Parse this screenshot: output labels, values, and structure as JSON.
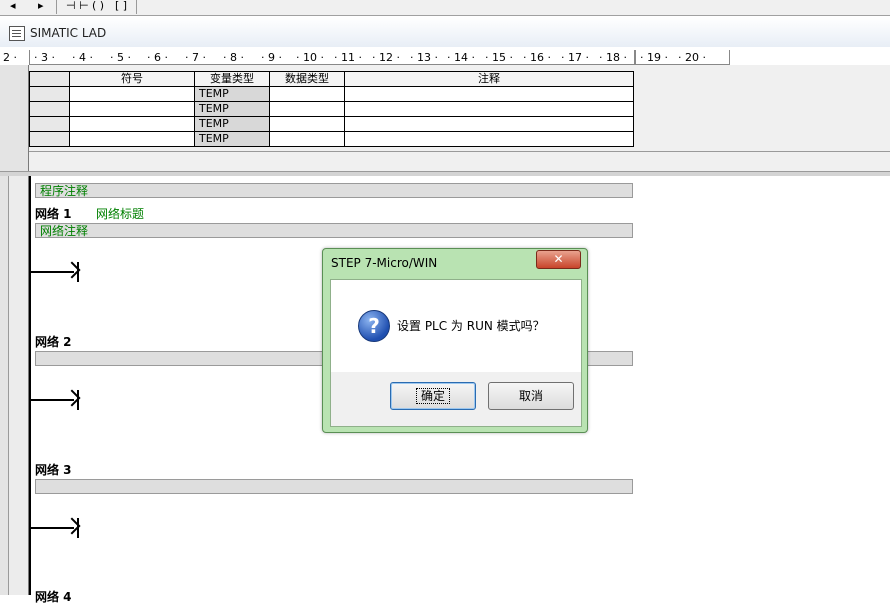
{
  "toolbar": {
    "items": [
      "◂",
      "▸",
      "⊣ ⊢",
      "( )",
      "[ ]"
    ]
  },
  "window": {
    "title": "SIMATIC LAD"
  },
  "ruler": {
    "lead": "2 ·",
    "ticks": [
      "· 3 ·",
      "· 4 ·",
      "· 5 ·",
      "· 6 ·",
      "· 7 ·",
      "· 8 ·",
      "· 9 ·",
      "· 10 ·",
      "· 11 ·",
      "· 12 ·",
      "· 13 ·",
      "· 14 ·",
      "· 15 ·",
      "· 16 ·",
      "· 17 ·",
      "· 18 ·",
      "· 19 ·",
      "· 20 ·"
    ]
  },
  "var_table": {
    "headers": [
      "符号",
      "变量类型",
      "数据类型",
      "注释"
    ],
    "rows": [
      {
        "var_type": "TEMP"
      },
      {
        "var_type": "TEMP"
      },
      {
        "var_type": "TEMP"
      },
      {
        "var_type": "TEMP"
      }
    ]
  },
  "ladder": {
    "program_comment": "程序注释",
    "networks": [
      {
        "label": "网络 1",
        "title": "网络标题",
        "comment": "网络注释"
      },
      {
        "label": "网络 2",
        "title": "",
        "comment": ""
      },
      {
        "label": "网络 3",
        "title": "",
        "comment": ""
      },
      {
        "label": "网络 4",
        "title": "",
        "comment": ""
      }
    ]
  },
  "dialog": {
    "title": "STEP 7-Micro/WIN",
    "close_label": "✕",
    "icon": "question-icon",
    "message": "设置 PLC 为 RUN 模式吗？",
    "ok_label": "确定",
    "cancel_label": "取消"
  }
}
